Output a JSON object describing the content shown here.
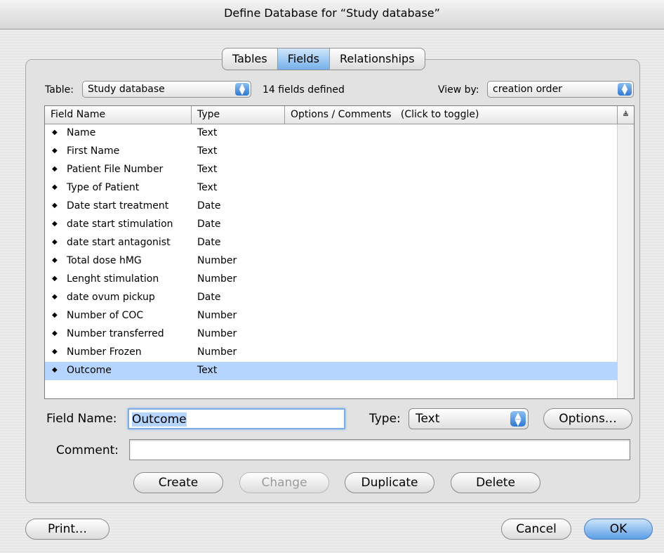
{
  "window": {
    "title": "Define Database for “Study database”"
  },
  "tabs": [
    {
      "label": "Tables",
      "active": false
    },
    {
      "label": "Fields",
      "active": true
    },
    {
      "label": "Relationships",
      "active": false
    }
  ],
  "toolbar": {
    "table_label": "Table:",
    "table_value": "Study database",
    "fields_count": "14 fields defined",
    "view_by_label": "View by:",
    "view_by_value": "creation order"
  },
  "table": {
    "columns": {
      "field_name": "Field Name",
      "type": "Type",
      "options": "Options / Comments",
      "options_hint": "(Click to toggle)"
    },
    "rows": [
      {
        "name": "Name",
        "type": "Text"
      },
      {
        "name": "First Name",
        "type": "Text"
      },
      {
        "name": "Patient File Number",
        "type": "Text"
      },
      {
        "name": "Type of Patient",
        "type": "Text"
      },
      {
        "name": "Date start treatment",
        "type": "Date"
      },
      {
        "name": "date start stimulation",
        "type": "Date"
      },
      {
        "name": "date start antagonist",
        "type": "Date"
      },
      {
        "name": "Total dose hMG",
        "type": "Number"
      },
      {
        "name": "Lenght stimulation",
        "type": "Number"
      },
      {
        "name": "date ovum pickup",
        "type": "Date"
      },
      {
        "name": "Number of COC",
        "type": "Number"
      },
      {
        "name": "Number transferred",
        "type": "Number"
      },
      {
        "name": "Number Frozen",
        "type": "Number"
      },
      {
        "name": "Outcome",
        "type": "Text",
        "selected": true
      }
    ]
  },
  "editor": {
    "field_name_label": "Field Name:",
    "field_name_value": "Outcome",
    "type_label": "Type:",
    "type_value": "Text",
    "options_button": "Options…",
    "comment_label": "Comment:",
    "comment_value": ""
  },
  "actions": {
    "create": "Create",
    "change": "Change",
    "duplicate": "Duplicate",
    "delete": "Delete"
  },
  "footer": {
    "print": "Print…",
    "cancel": "Cancel",
    "ok": "OK"
  },
  "icons": {
    "row_handle": "updown-arrows-icon",
    "popup_arrows": "updown-arrows-icon",
    "sort": "sort-icon"
  },
  "colors": {
    "selection": "#b5d5fe",
    "accent": "#5c9ee6"
  }
}
